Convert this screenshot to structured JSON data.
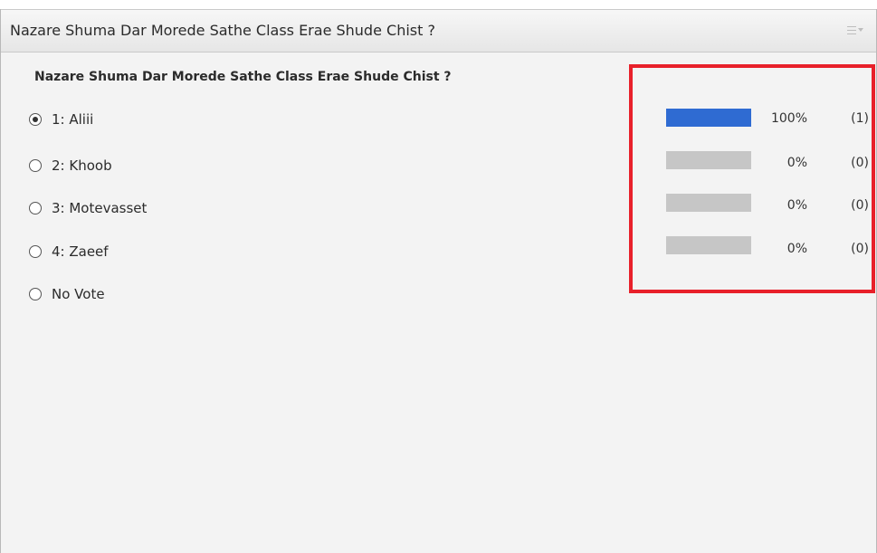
{
  "pod": {
    "title": "Nazare Shuma Dar Morede Sathe Class Erae Shude Chist ?",
    "menu_icon": "hamburger-menu-icon"
  },
  "question": "Nazare Shuma Dar Morede Sathe Class Erae Shude Chist ?",
  "options": [
    {
      "label": "1: Aliii",
      "selected": true
    },
    {
      "label": "2: Khoob",
      "selected": false
    },
    {
      "label": "3: Motevasset",
      "selected": false
    },
    {
      "label": "4: Zaeef",
      "selected": false
    },
    {
      "label": "No Vote",
      "selected": false
    }
  ],
  "results": [
    {
      "percent_label": "100%",
      "count_label": "(1)",
      "fraction": 1.0
    },
    {
      "percent_label": "0%",
      "count_label": "(0)",
      "fraction": 0.0
    },
    {
      "percent_label": "0%",
      "count_label": "(0)",
      "fraction": 0.0
    },
    {
      "percent_label": "0%",
      "count_label": "(0)",
      "fraction": 0.0
    }
  ],
  "colors": {
    "bar_fill": "#2f6bd2",
    "bar_track": "#c6c6c6",
    "highlight": "#e8202a"
  }
}
